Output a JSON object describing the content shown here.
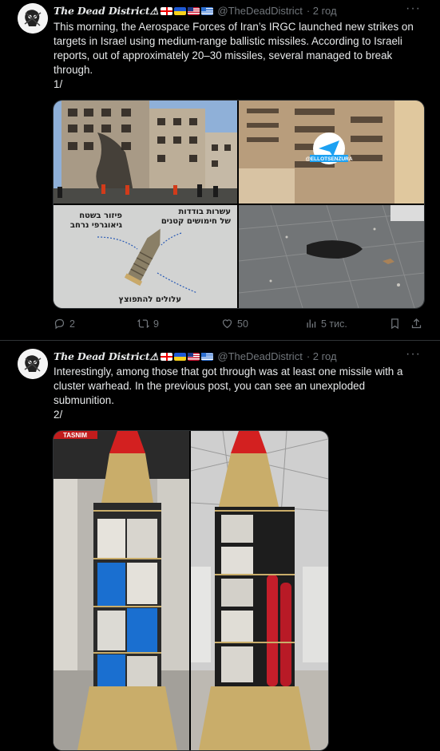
{
  "posts": [
    {
      "display_name": "The Dead District⚠",
      "handle": "@TheDeadDistrict",
      "time": "· 2 год",
      "text": "This morning, the Aerospace Forces of Iran’s IRGC launched new  strikes on targets in Israel using medium-range ballistic missiles. According to Israeli reports, out of approximately 20–30 missiles, several managed to break through.\n1/",
      "annotations": {
        "top": "עשרות בודדות\nשל חימושים קטנים",
        "left": "פיזור בשטח\nגיאוגרפי נרחב",
        "bottom": "עלולים להתפוצץ"
      },
      "watermark": "@ELLOTSENZURA",
      "actions": {
        "replies": "2",
        "reposts": "9",
        "likes": "50",
        "views": "5 тис."
      }
    },
    {
      "display_name": "The Dead District⚠",
      "handle": "@TheDeadDistrict",
      "time": "· 2 год",
      "text": "Interestingly, among those that got through was at least one missile with a cluster warhead. In the previous post, you can see an unexploded submunition.\n2/",
      "logo_text": "TASNIM"
    }
  ],
  "icons": {
    "more": "more-icon",
    "reply": "reply-icon",
    "repost": "repost-icon",
    "like": "like-icon",
    "views": "views-icon",
    "bookmark": "bookmark-icon",
    "share": "share-icon"
  },
  "colors": {
    "background": "#000000",
    "text": "#e7e9ea",
    "secondary": "#71767b",
    "border": "#2f3336"
  }
}
